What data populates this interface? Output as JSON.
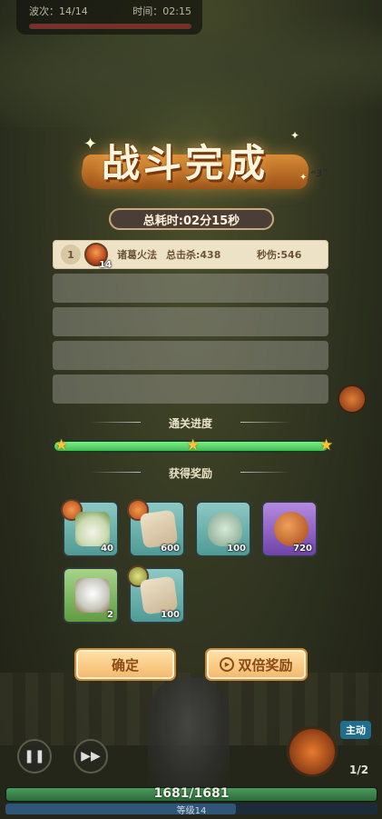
{
  "hud": {
    "wave_label": "波次：14/14",
    "time_label": "时间：02:15"
  },
  "title": {
    "text": "战斗完成",
    "deco_text": "“3”"
  },
  "total_time": "总耗时:02分15秒",
  "stats": {
    "rows": [
      {
        "rank": "1",
        "hero_level": "14",
        "hero_name": "诸葛火法",
        "kills": "总击杀:438",
        "dps": "秒伤:546"
      }
    ],
    "empty_rows": 4
  },
  "progress": {
    "label": "通关进度",
    "value": 1.0,
    "stars_earned": 3,
    "stars_total": 3
  },
  "rewards": {
    "label": "获得奖励",
    "items": [
      {
        "count": "40",
        "icon": "tea-bowl-icon",
        "color": "teal",
        "has_hero_badge": true
      },
      {
        "count": "600",
        "icon": "scroll-icon",
        "color": "teal",
        "has_hero_badge": true
      },
      {
        "count": "100",
        "icon": "jade-token-icon",
        "color": "teal",
        "has_hero_badge": false
      },
      {
        "count": "720",
        "icon": "bean-icon",
        "color": "purple",
        "has_hero_badge": false
      },
      {
        "count": "2",
        "icon": "teapot-icon",
        "color": "green",
        "has_hero_badge": false
      },
      {
        "count": "100",
        "icon": "scroll-icon",
        "color": "teal",
        "has_hero_badge": true
      }
    ]
  },
  "buttons": {
    "confirm_label": "确定",
    "double_label": "双倍奖励"
  },
  "bottom_hud": {
    "auto_label": "主动",
    "wave_ratio": "1/2",
    "hp_text": "1681/1681",
    "level_text": "等级14",
    "level_progress": 0.62
  },
  "colors": {
    "accent_orange": "#f3b86b",
    "progress_green": "#3fbe53",
    "star_gold": "#f6c53a"
  }
}
